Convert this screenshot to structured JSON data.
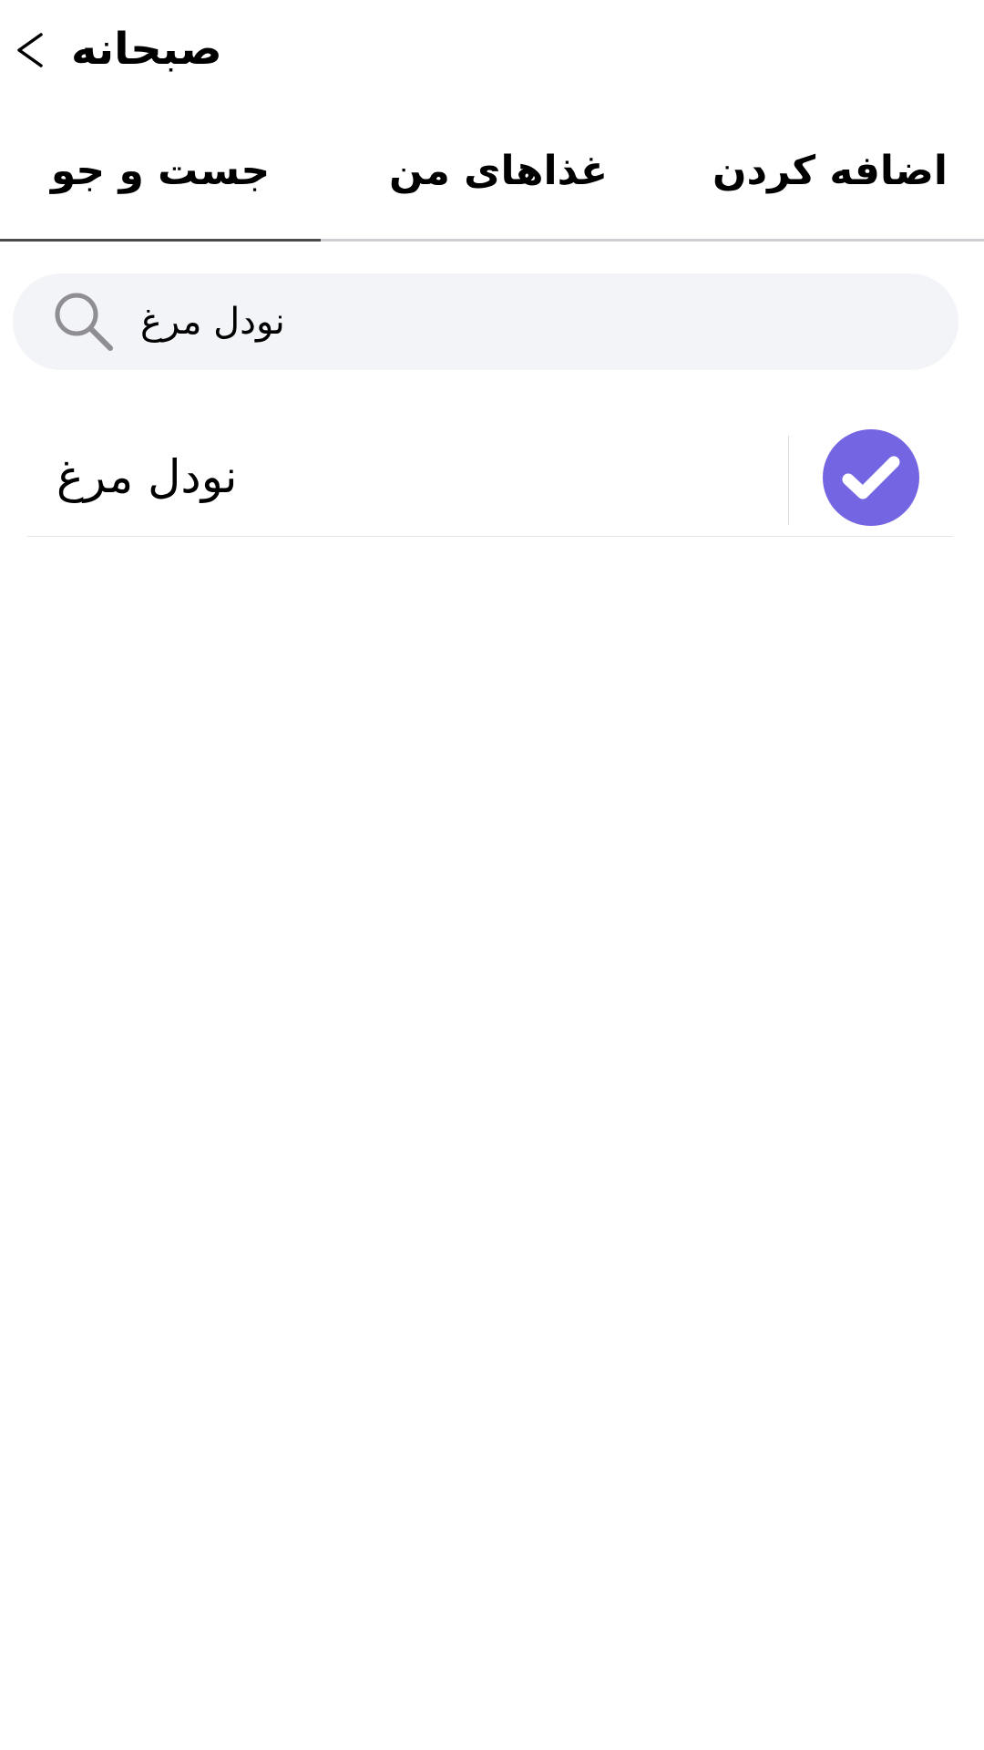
{
  "header": {
    "title": "صبحانه",
    "back_icon": "chevron-left-icon"
  },
  "tabs": [
    {
      "label": "جست و جو",
      "active": true
    },
    {
      "label": "غذاهای من",
      "active": false
    },
    {
      "label": "اضافه کردن",
      "active": false
    }
  ],
  "search": {
    "value": "نودل مرغ",
    "icon": "search-icon"
  },
  "results": [
    {
      "name": "نودل مرغ",
      "selected": true,
      "icon": "check-icon"
    }
  ],
  "colors": {
    "accent": "#7466e2",
    "search_bg": "#f3f4f8",
    "tab_indicator": "#4a4a4a"
  }
}
